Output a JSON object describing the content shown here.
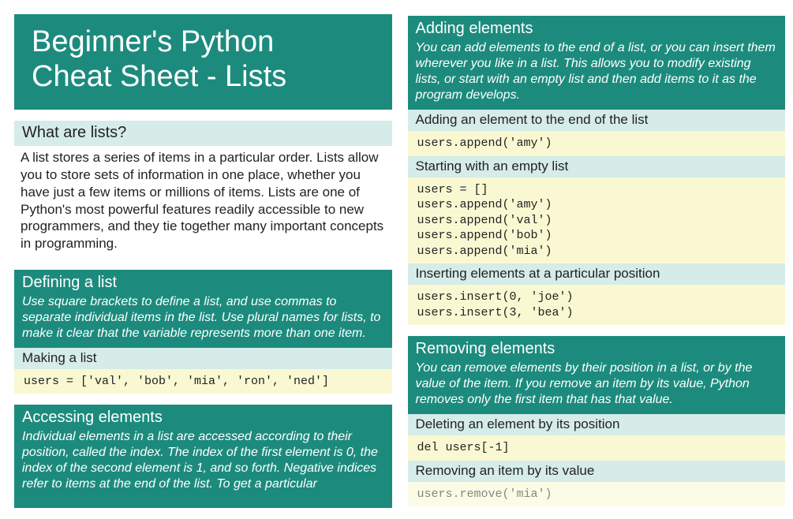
{
  "title": "Beginner's Python\nCheat Sheet - Lists",
  "left": {
    "what_head": "What are lists?",
    "what_body": "A list stores a series of items in a particular order. Lists allow you to store sets of information in one place, whether you have just a few items or millions of items. Lists are one of Python's most powerful features readily accessible to new programmers, and they tie together many important concepts in programming.",
    "def_head": "Defining a list",
    "def_intro": "Use square brackets to define a list, and use commas to separate individual items in the list. Use plural names for lists, to make it clear that the variable represents more than one item.",
    "def_sub": "Making a list",
    "def_code": "users = ['val', 'bob', 'mia', 'ron', 'ned']",
    "acc_head": "Accessing elements",
    "acc_intro": "Individual elements in a list are accessed according to their position, called the index. The index of the first element is 0, the index of the second element is 1, and so forth. Negative indices refer to items at the end of the list. To get a particular"
  },
  "right": {
    "add_head": "Adding elements",
    "add_intro": "You can add elements to the end of a list, or you can insert them wherever you like in a list. This allows you to modify existing lists, or start with an empty list and then add items to it as the program develops.",
    "add_sub1": "Adding an element to the end of the list",
    "add_code1": "users.append('amy')",
    "add_sub2": "Starting with an empty list",
    "add_code2": "users = []\nusers.append('amy')\nusers.append('val')\nusers.append('bob')\nusers.append('mia')",
    "add_sub3": "Inserting elements at a particular position",
    "add_code3": "users.insert(0, 'joe')\nusers.insert(3, 'bea')",
    "rem_head": "Removing elements",
    "rem_intro": "You can remove elements by their position in a list, or by the value of the item. If you remove an item by its value, Python removes only the first item that has that value.",
    "rem_sub1": "Deleting an element by its position",
    "rem_code1": "del users[-1]",
    "rem_sub2": "Removing an item by its value",
    "rem_code2": "users.remove('mia')"
  }
}
